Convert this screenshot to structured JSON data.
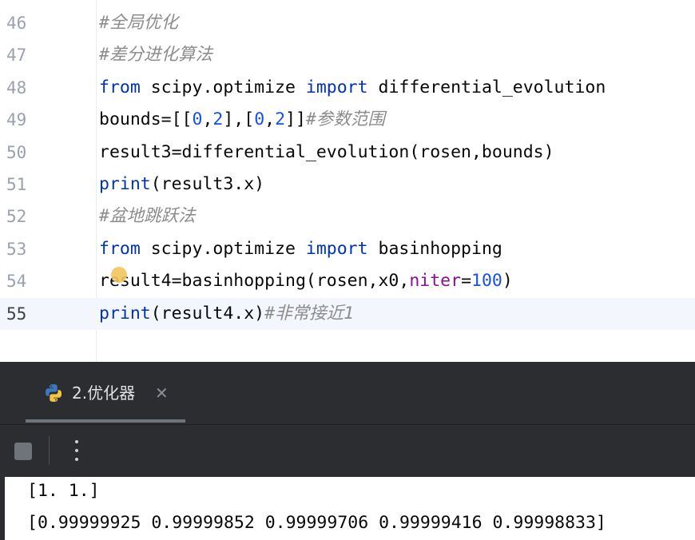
{
  "editor": {
    "lines": [
      {
        "number": "46",
        "tokens": [
          {
            "t": "#全局优化",
            "c": "cmt"
          }
        ]
      },
      {
        "number": "47",
        "tokens": [
          {
            "t": "#差分进化算法",
            "c": "cmt"
          }
        ]
      },
      {
        "number": "48",
        "tokens": [
          {
            "t": "from",
            "c": "kw"
          },
          {
            "t": " scipy.optimize ",
            "c": ""
          },
          {
            "t": "import",
            "c": "kw"
          },
          {
            "t": " differential_evolution",
            "c": ""
          }
        ]
      },
      {
        "number": "49",
        "tokens": [
          {
            "t": "bounds=[[",
            "c": ""
          },
          {
            "t": "0",
            "c": "num"
          },
          {
            "t": ",",
            "c": ""
          },
          {
            "t": "2",
            "c": "num"
          },
          {
            "t": "],[",
            "c": ""
          },
          {
            "t": "0",
            "c": "num"
          },
          {
            "t": ",",
            "c": ""
          },
          {
            "t": "2",
            "c": "num"
          },
          {
            "t": "]]",
            "c": ""
          },
          {
            "t": "#参数范围",
            "c": "cmt"
          }
        ]
      },
      {
        "number": "50",
        "tokens": [
          {
            "t": "result3=differential_evolution(rosen,bounds)",
            "c": ""
          }
        ]
      },
      {
        "number": "51",
        "tokens": [
          {
            "t": "print",
            "c": "kw"
          },
          {
            "t": "(result3.x)",
            "c": ""
          }
        ]
      },
      {
        "number": "52",
        "tokens": [
          {
            "t": "#盆地跳跃法",
            "c": "cmt"
          }
        ]
      },
      {
        "number": "53",
        "tokens": [
          {
            "t": "from",
            "c": "kw"
          },
          {
            "t": " scipy.optimize ",
            "c": ""
          },
          {
            "t": "import",
            "c": "kw"
          },
          {
            "t": " basinhopping",
            "c": ""
          }
        ]
      },
      {
        "number": "54",
        "tokens": [
          {
            "t": "result4=basinhopping(rosen,x0,",
            "c": ""
          },
          {
            "t": "niter",
            "c": "param"
          },
          {
            "t": "=",
            "c": ""
          },
          {
            "t": "100",
            "c": "num"
          },
          {
            "t": ")",
            "c": ""
          }
        ]
      },
      {
        "number": "55",
        "current": true,
        "tokens": [
          {
            "t": "print",
            "c": "kw"
          },
          {
            "t": "(result4.x)",
            "c": ""
          },
          {
            "t": "#非常接近1",
            "c": "cmt"
          }
        ]
      }
    ]
  },
  "run_panel": {
    "tab_title": "2.优化器",
    "tab_close": "✕",
    "tab_icon": "python-icon",
    "stop_icon": "stop-icon",
    "more_icon": "more-vertical-icon"
  },
  "console": {
    "lines": [
      "[1. 1.]",
      "[0.99999925 0.99999852 0.99999706 0.99999416 0.99998833]"
    ]
  },
  "colors": {
    "keyword": "#0033b3",
    "number": "#1750eb",
    "comment": "#8c8c8c",
    "param": "#871094",
    "panel_bg": "#2b2d30"
  }
}
